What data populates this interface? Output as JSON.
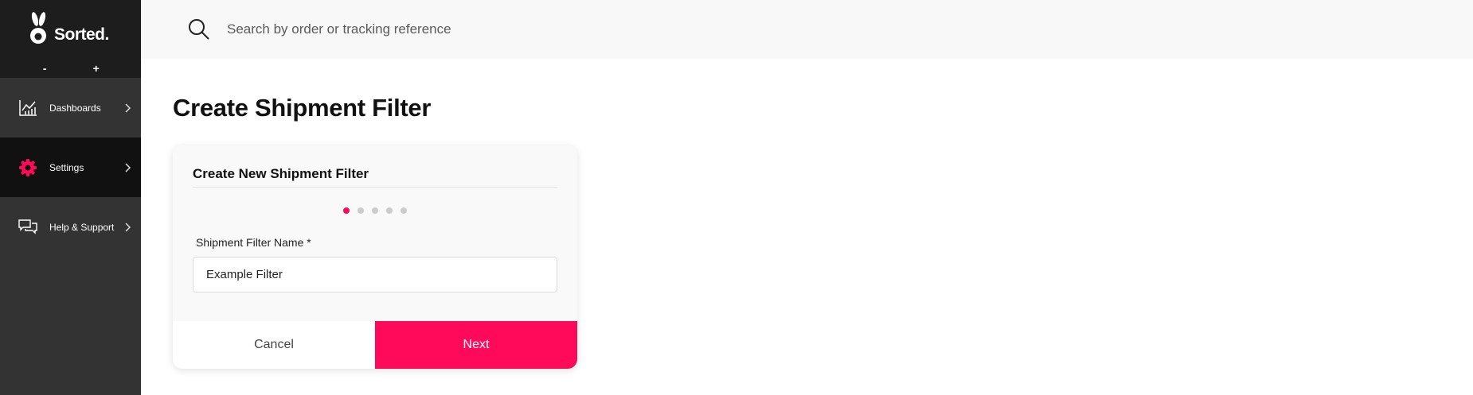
{
  "brand": {
    "name": "Sorted.",
    "accent": "#ff0a5a"
  },
  "zoom": {
    "minus": "-",
    "plus": "+"
  },
  "sidebar": {
    "items": [
      {
        "label": "Dashboards",
        "icon": "chart-icon",
        "active": false
      },
      {
        "label": "Settings",
        "icon": "gear-icon",
        "active": true
      },
      {
        "label": "Help & Support",
        "icon": "chat-icon",
        "active": false
      }
    ]
  },
  "search": {
    "placeholder": "Search by order or tracking reference",
    "icon": "search-icon"
  },
  "page": {
    "title": "Create Shipment Filter"
  },
  "form": {
    "title": "Create New Shipment Filter",
    "steps_total": 5,
    "current_step": 1,
    "field_label": "Shipment Filter Name *",
    "field_value": "Example Filter",
    "cancel_label": "Cancel",
    "next_label": "Next"
  }
}
